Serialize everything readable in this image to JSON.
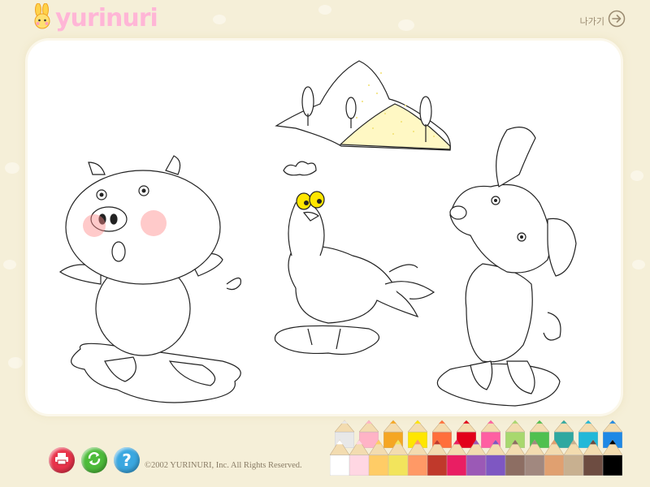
{
  "header": {
    "logo_text": "yurinuri",
    "logo_icon": "rabbit-icon",
    "exit_label": "나가기",
    "exit_icon": "arrow-right-circle-icon"
  },
  "toolbar": {
    "print_icon": "printer-icon",
    "refresh_icon": "refresh-icon",
    "help_icon": "question-mark-icon",
    "print_color": "#e8334a",
    "refresh_color": "#4dbb3a",
    "help_color": "#3aa7e0"
  },
  "footer": {
    "copyright": "©2002 YURINURI, Inc. All Rights Reserved."
  },
  "palette": {
    "top_row": [
      "#e8e8e8",
      "#ffb3c6",
      "#f5a623",
      "#ffe600",
      "#ff6f3c",
      "#e2001a",
      "#ff5fa2",
      "#a8d86e",
      "#4fc04f",
      "#2fa8a0",
      "#22b8d8",
      "#1e88e5"
    ],
    "bottom_row": [
      "#ffffff",
      "#ffd7e3",
      "#ffcc66",
      "#f2e45c",
      "#ff9966",
      "#c0392b",
      "#e91e63",
      "#9b59b6",
      "#7e57c2",
      "#8d6e63",
      "#a1887f",
      "#e0a070",
      "#c8b090",
      "#6d4c41",
      "#000000"
    ]
  }
}
